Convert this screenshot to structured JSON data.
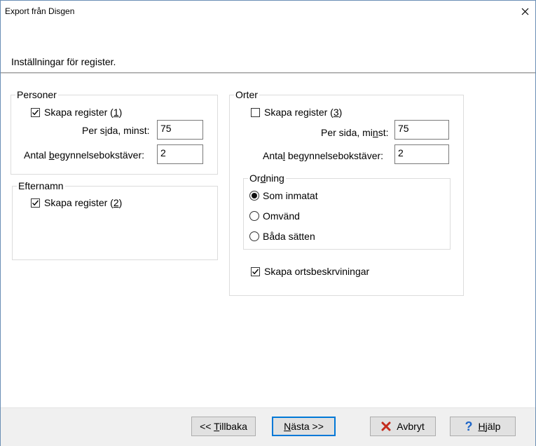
{
  "window": {
    "title": "Export från Disgen"
  },
  "header": {
    "text": "Inställningar för register."
  },
  "personer": {
    "legend": "Personer",
    "create_pre": "Skapa register (",
    "create_key": "1",
    "create_post": ")",
    "create_checked": true,
    "per_page_pre": "Per s",
    "per_page_key": "i",
    "per_page_post": "da, minst:",
    "per_page_value": "75",
    "initials_pre": "Antal ",
    "initials_key": "b",
    "initials_post": "egynnelsebokstäver:",
    "initials_value": "2"
  },
  "efternamn": {
    "legend": "Efternamn",
    "create_pre": "Skapa register (",
    "create_key": "2",
    "create_post": ")",
    "create_checked": true
  },
  "orter": {
    "legend": "Orter",
    "create_pre": "Skapa register (",
    "create_key": "3",
    "create_post": ")",
    "create_checked": false,
    "per_page_pre": "Per sida, mi",
    "per_page_key": "n",
    "per_page_post": "st:",
    "per_page_value": "75",
    "initials_pre": "Anta",
    "initials_key": "l",
    "initials_post": " begynnelsebokstäver:",
    "initials_value": "2",
    "ordning": {
      "legend_pre": "Or",
      "legend_key": "d",
      "legend_post": "ning",
      "options": [
        "Som inmatat",
        "Omvänd",
        "Båda sätten"
      ],
      "selected": "Som inmatat"
    },
    "desc_label": "Skapa ortsbeskrviningar",
    "desc_checked": true
  },
  "buttons": {
    "back_pre": "<< ",
    "back_key": "T",
    "back_post": "illbaka",
    "next_key": "N",
    "next_post": "ästa >>",
    "cancel": "Avbryt",
    "help_key": "H",
    "help_post": "jälp"
  },
  "colors": {
    "accent": "#0078d7",
    "cancel_icon": "#c42b1c",
    "help_icon": "#1e66c8"
  }
}
